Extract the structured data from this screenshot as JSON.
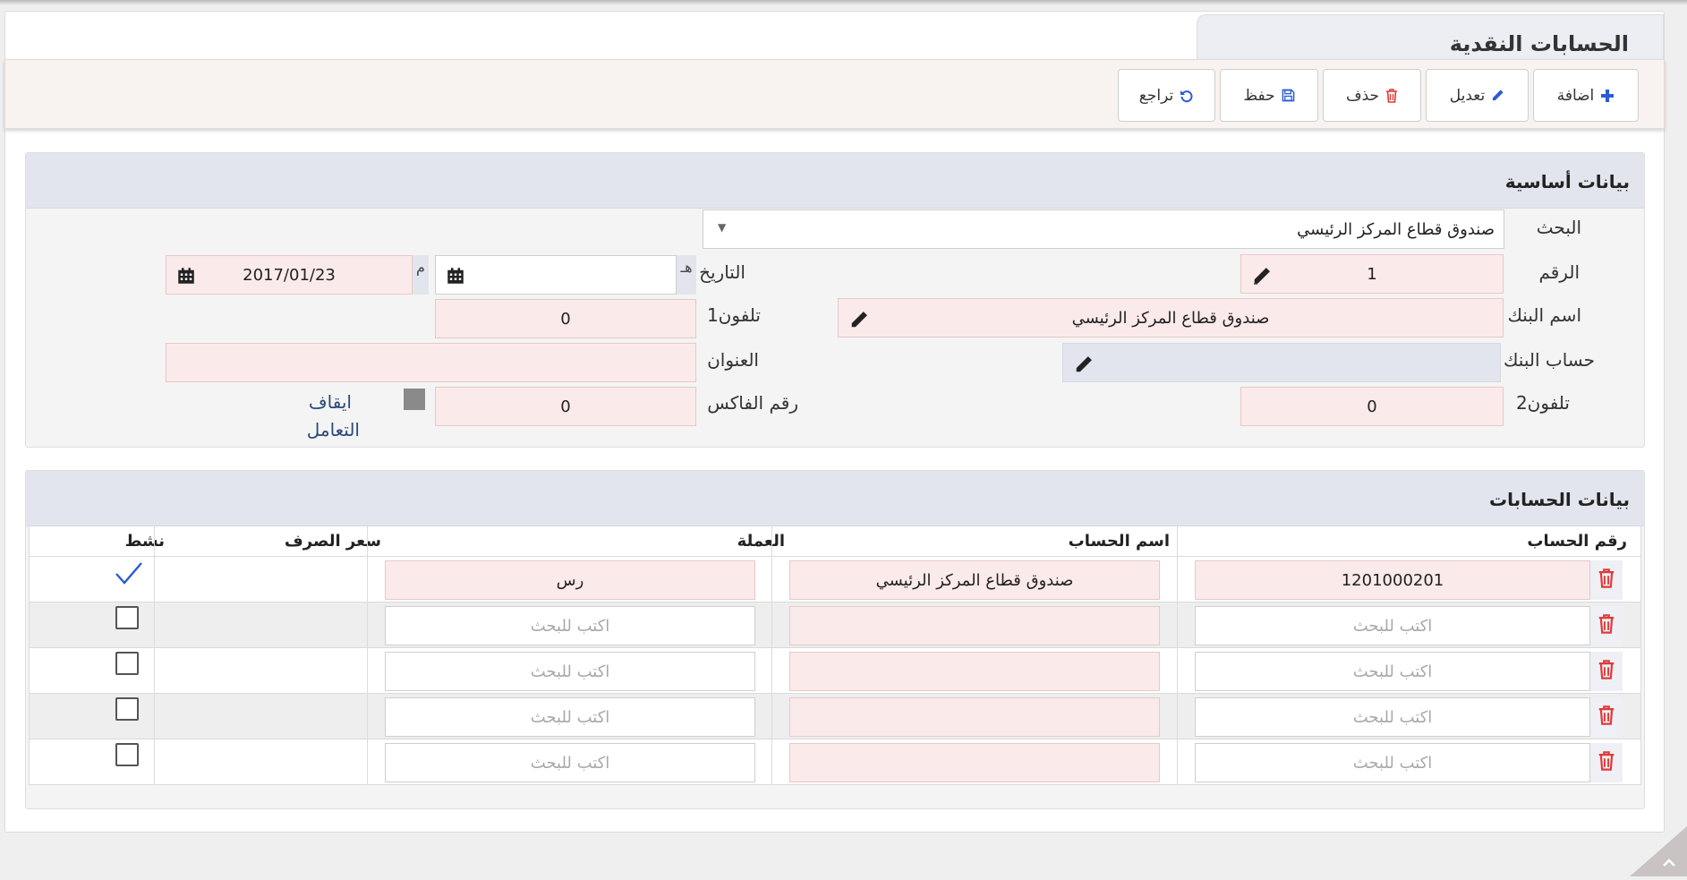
{
  "page": {
    "title": "الحسابات النقدية"
  },
  "toolbar": {
    "add": "اضافة",
    "edit": "تعديل",
    "delete": "حذف",
    "save": "حفظ",
    "undo": "تراجع"
  },
  "basic": {
    "title": "بيانات أساسية",
    "search_label": "البحث",
    "search_value": "صندوق قطاع المركز الرئيسي",
    "number_label": "الرقم",
    "number_value": "1",
    "date_label": "التاريخ",
    "hijri_marker": "هـ",
    "gregorian_marker": "م",
    "hijri_value": "",
    "gregorian_value": "2017/01/23",
    "bank_name_label": "اسم البنك",
    "bank_name_value": "صندوق قطاع المركز الرئيسي",
    "phone1_label": "تلفون1",
    "phone1_value": "0",
    "bank_account_label": "حساب البنك",
    "bank_account_value": "",
    "address_label": "العنوان",
    "address_value": "",
    "phone2_label": "تلفون2",
    "phone2_value": "0",
    "fax_label": "رقم الفاكس",
    "fax_value": "0",
    "stop_label_line1": "ايقاف",
    "stop_label_line2": "التعامل"
  },
  "accounts": {
    "title": "بيانات الحسابات",
    "headers": {
      "account_no": "رقم الحساب",
      "account_name": "اسم الحساب",
      "currency": "العملة",
      "exchange_rate": "سعر الصرف",
      "active": "نشط"
    },
    "placeholder": "اكتب للبحث",
    "rows": [
      {
        "account_no": "1201000201",
        "account_name": "صندوق قطاع  المركز الرئيسي",
        "currency": "رس",
        "exchange_rate": "",
        "active": true
      },
      {
        "account_no": "",
        "account_name": "",
        "currency": "",
        "exchange_rate": "",
        "active": false
      },
      {
        "account_no": "",
        "account_name": "",
        "currency": "",
        "exchange_rate": "",
        "active": false
      },
      {
        "account_no": "",
        "account_name": "",
        "currency": "",
        "exchange_rate": "",
        "active": false
      },
      {
        "account_no": "",
        "account_name": "",
        "currency": "",
        "exchange_rate": "",
        "active": false
      }
    ]
  },
  "colors": {
    "accent_blue": "#2a5bd7",
    "delete_red": "#e03a3a",
    "field_pink": "#fbeaea",
    "panel_header": "#e2e5ed"
  }
}
